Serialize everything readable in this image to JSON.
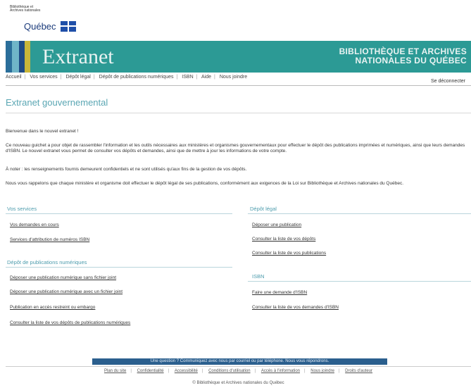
{
  "logo": {
    "small_text": "Bibliothèque et Archives nationales",
    "quebec": "Québec",
    "flag_icon": "quebec-flag-icon"
  },
  "banner": {
    "title": "Extranet",
    "org_line1": "BIBLIOTHÈQUE ET ARCHIVES",
    "org_line2": "NATIONALES DU QUÉBEC"
  },
  "nav": {
    "items": [
      "Accueil",
      "Vos services",
      "Dépôt légal",
      "Dépôt de publications numériques",
      "ISBN",
      "Aide",
      "Nous joindre"
    ],
    "logout": "Se déconnecter"
  },
  "page": {
    "title": "Extranet gouvernemental",
    "welcome": "Bienvenue dans le nouvel extranet !",
    "intro": "Ce nouveau guichet a pour objet de rassembler l'information et les outils nécessaires aux ministères et organismes gouvernementaux pour effectuer le dépôt des publications imprimées et numériques, ainsi que leurs demandes d'ISBN. Le nouvel extranet vous permet de consulter vos dépôts et demandes, ainsi que de mettre à jour les informations de votre compte.",
    "access": "À noter : les renseignements fournis demeurent confidentiels et ne sont utilisés qu'aux fins de la gestion de vos dépôts.",
    "reminder": "Nous vous rappelons que chaque ministère et organisme doit effectuer le dépôt légal de ses publications, conformément aux exigences de la Loi sur Bibliothèque et Archives nationales du Québec."
  },
  "sections": {
    "services": {
      "title": "Vos services",
      "links": [
        "Vos demandes en cours",
        "Services d'attribution de numéros ISBN"
      ]
    },
    "numeriques": {
      "title": "Dépôt de publications numériques",
      "links": [
        "Déposer une publication numérique sans fichier joint",
        "Déposer une publication numérique avec un fichier joint",
        "Publication en accès restreint ou embargo",
        "Consulter la liste de vos dépôts de publications numériques"
      ]
    },
    "depot": {
      "title": "Dépôt légal",
      "links": [
        "Déposer une publication",
        "Consulter la liste de vos dépôts",
        "Consulter la liste de vos publications"
      ]
    },
    "isbn": {
      "title": "ISBN",
      "links": [
        "Faire une demande d'ISBN",
        "Consulter la liste de vos demandes d'ISBN"
      ]
    }
  },
  "footer": {
    "bar": "Une question ? Communiquez avec nous par courriel ou par téléphone. Nous vous répondrons.",
    "links": [
      "Plan du site",
      "Confidentialité",
      "Accessibilité",
      "Conditions d'utilisation",
      "Accès à l'information",
      "Nous joindre",
      "Droits d'auteur"
    ],
    "copyright": "© Bibliothèque et Archives nationales du Québec"
  }
}
